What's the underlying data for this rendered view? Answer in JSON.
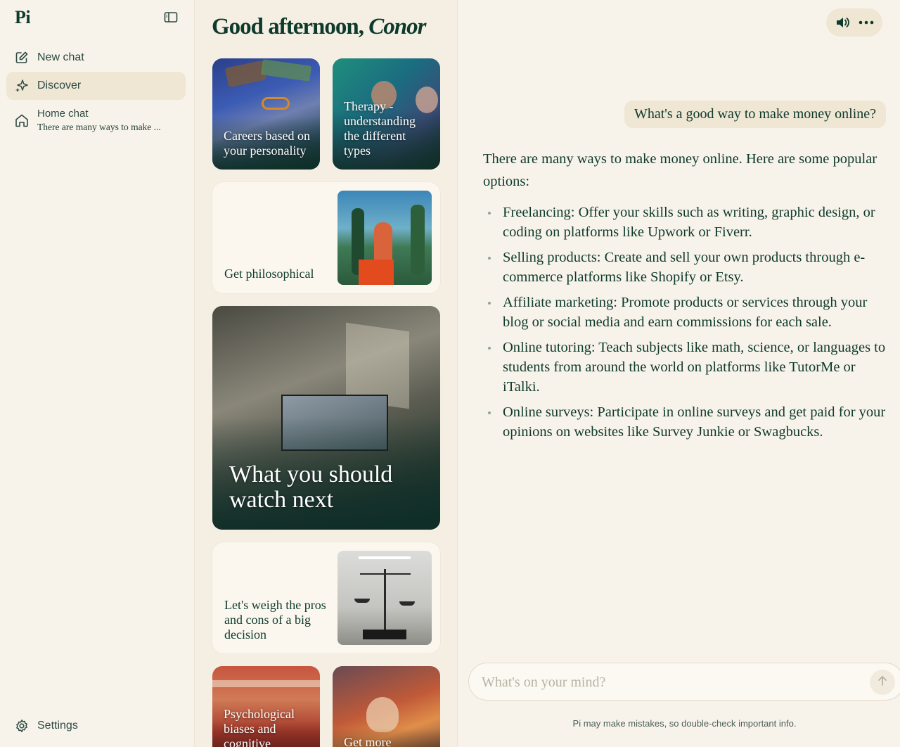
{
  "app": {
    "logo": "Pi"
  },
  "sidebar": {
    "new_chat": "New chat",
    "discover": "Discover",
    "home_chat": {
      "title": "Home chat",
      "preview": "There are many ways to make ..."
    },
    "settings": "Settings"
  },
  "discover": {
    "greeting_prefix": "Good afternoon, ",
    "greeting_name": "Conor",
    "cards": [
      {
        "label": "Careers based on your personality"
      },
      {
        "label": "Therapy - understanding the different types"
      },
      {
        "label": "Get philosophical"
      },
      {
        "label": "What you should watch next"
      },
      {
        "label": "Let's weigh the pros and cons of a big decision"
      },
      {
        "label": "Psychological biases and cognitive"
      },
      {
        "label": "Get more"
      }
    ]
  },
  "chat": {
    "user_message": "What's a good way to make money online?",
    "ai_intro": "There are many ways to make money online. Here are some popular options:",
    "ai_items": [
      "Freelancing: Offer your skills such as writing, graphic design, or coding on platforms like Upwork or Fiverr.",
      "Selling products: Create and sell your own products through e-commerce platforms like Shopify or Etsy.",
      "Affiliate marketing: Promote products or services through your blog or social media and earn commissions for each sale.",
      "Online tutoring: Teach subjects like math, science, or languages to students from around the world on platforms like TutorMe or iTalki.",
      "Online surveys: Participate in online surveys and get paid for your opinions on websites like Survey Junkie or Swagbucks."
    ],
    "input_placeholder": "What's on your mind?",
    "disclaimer": "Pi may make mistakes, so double-check important info."
  },
  "colors": {
    "accent": "#0e3a2c",
    "background": "#f8f3ea",
    "highlight": "#efe6d4"
  }
}
